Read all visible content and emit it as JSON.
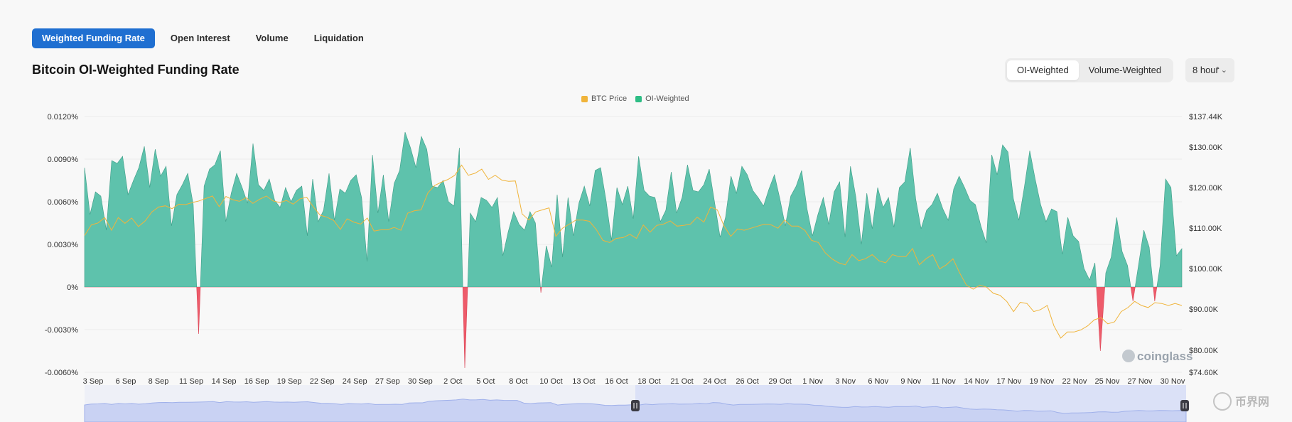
{
  "tabs": [
    "Weighted Funding Rate",
    "Open Interest",
    "Volume",
    "Liquidation"
  ],
  "title": "Bitcoin OI-Weighted Funding Rate",
  "weighting_options": [
    "OI-Weighted",
    "Volume-Weighted"
  ],
  "interval": {
    "label": "8 hour",
    "icon": "chevron-up-down-icon"
  },
  "watermarks": {
    "brand": "coinglass",
    "site": "币界网"
  },
  "colors": {
    "positive": "#5ec2ac",
    "negative": "#ee5b6a",
    "btc_price": "#f0b43b",
    "active_tab": "#1f6fd1"
  },
  "chart_data": {
    "type": "area",
    "legend": [
      "BTC Price",
      "OI-Weighted"
    ],
    "legend_position": "top-center",
    "grid": true,
    "y_left": {
      "ticks": [
        "0.0120%",
        "0.0090%",
        "0.0060%",
        "0.0030%",
        "0%",
        "-0.0030%",
        "-0.0060%"
      ],
      "range": [
        -0.006,
        0.012
      ],
      "unit": "%"
    },
    "y_right": {
      "ticks": [
        "$137.44K",
        "$130.00K",
        "$120.00K",
        "$110.00K",
        "$100.00K",
        "$90.00K",
        "$80.00K",
        "$74.60K"
      ]
    },
    "x_ticks": [
      "3 Sep",
      "6 Sep",
      "8 Sep",
      "11 Sep",
      "14 Sep",
      "16 Sep",
      "19 Sep",
      "22 Sep",
      "24 Sep",
      "27 Sep",
      "30 Sep",
      "2 Oct",
      "5 Oct",
      "8 Oct",
      "10 Oct",
      "13 Oct",
      "16 Oct",
      "18 Oct",
      "21 Oct",
      "24 Oct",
      "26 Oct",
      "29 Oct",
      "1 Nov",
      "3 Nov",
      "6 Nov",
      "9 Nov",
      "11 Nov",
      "14 Nov",
      "17 Nov",
      "19 Nov",
      "22 Nov",
      "25 Nov",
      "27 Nov",
      "30 Nov"
    ],
    "series": [
      {
        "name": "OI-Weighted",
        "unit": "%",
        "values": [
          0.0084,
          0.0051,
          0.0067,
          0.0064,
          0.004,
          0.0089,
          0.0087,
          0.0092,
          0.0065,
          0.0075,
          0.0084,
          0.0099,
          0.007,
          0.0097,
          0.0078,
          0.0085,
          0.0043,
          0.0065,
          0.0072,
          0.008,
          0.0058,
          -0.0033,
          0.0071,
          0.0083,
          0.0086,
          0.0096,
          0.0046,
          0.0066,
          0.008,
          0.007,
          0.0059,
          0.0101,
          0.0072,
          0.0068,
          0.0076,
          0.0061,
          0.0056,
          0.007,
          0.006,
          0.0068,
          0.0071,
          0.0036,
          0.0076,
          0.0046,
          0.0054,
          0.008,
          0.0047,
          0.0069,
          0.0066,
          0.0075,
          0.0079,
          0.0063,
          0.0018,
          0.0093,
          0.0052,
          0.0079,
          0.0046,
          0.0073,
          0.0082,
          0.0109,
          0.0098,
          0.0084,
          0.0106,
          0.0097,
          0.0071,
          0.007,
          0.0075,
          0.006,
          0.0057,
          0.0098,
          -0.0057,
          0.0052,
          0.0046,
          0.0063,
          0.0061,
          0.0056,
          0.0063,
          0.0022,
          0.0039,
          0.0053,
          0.0044,
          0.004,
          0.0053,
          0.0045,
          -0.0004,
          0.0029,
          0.0014,
          0.0065,
          0.0021,
          0.0063,
          0.0036,
          0.0059,
          0.0071,
          0.0057,
          0.0082,
          0.0084,
          0.0061,
          0.0033,
          0.007,
          0.0058,
          0.0071,
          0.0048,
          0.0092,
          0.0068,
          0.0064,
          0.0063,
          0.0046,
          0.0054,
          0.0081,
          0.0052,
          0.0063,
          0.0086,
          0.0068,
          0.0067,
          0.0072,
          0.0083,
          0.0059,
          0.0035,
          0.0049,
          0.0078,
          0.0066,
          0.0085,
          0.0079,
          0.0068,
          0.0063,
          0.0057,
          0.0069,
          0.0079,
          0.0062,
          0.0043,
          0.0064,
          0.0071,
          0.0082,
          0.0055,
          0.0036,
          0.0051,
          0.0063,
          0.0044,
          0.0067,
          0.0074,
          0.0035,
          0.0085,
          0.0063,
          0.003,
          0.0066,
          0.0041,
          0.007,
          0.0056,
          0.0063,
          0.0042,
          0.007,
          0.0074,
          0.0098,
          0.0062,
          0.0041,
          0.0054,
          0.0058,
          0.0066,
          0.0055,
          0.0047,
          0.0069,
          0.0078,
          0.007,
          0.0061,
          0.0058,
          0.0043,
          0.0031,
          0.0093,
          0.0079,
          0.01,
          0.0095,
          0.0062,
          0.0047,
          0.007,
          0.0096,
          0.0076,
          0.0058,
          0.0046,
          0.0055,
          0.0053,
          0.0023,
          0.0049,
          0.0036,
          0.0032,
          0.0013,
          0.0005,
          0.0017,
          -0.0045,
          0.001,
          0.0021,
          0.0049,
          0.0025,
          0.0015,
          -0.001,
          0.0015,
          0.004,
          0.0028,
          -0.001,
          0.0015,
          0.0076,
          0.007,
          0.0022,
          0.0027
        ]
      },
      {
        "name": "BTC Price",
        "unit": "USD",
        "values": [
          108200,
          110800,
          111300,
          112600,
          109500,
          112600,
          111200,
          112500,
          110400,
          111800,
          114000,
          115200,
          115500,
          114800,
          115900,
          115800,
          116300,
          116700,
          117300,
          117900,
          115300,
          117800,
          117000,
          116600,
          117500,
          116100,
          117100,
          117900,
          116700,
          116300,
          116800,
          115900,
          117200,
          117600,
          115200,
          113200,
          112700,
          111900,
          109700,
          112300,
          111500,
          111000,
          112500,
          109300,
          109600,
          109600,
          110200,
          109500,
          113700,
          114300,
          114500,
          118700,
          120500,
          121300,
          122000,
          123000,
          125500,
          123000,
          123500,
          124500,
          122000,
          123000,
          121800,
          121500,
          121600,
          113500,
          112000,
          114000,
          114500,
          115000,
          108000,
          110000,
          111000,
          112000,
          112000,
          111700,
          109700,
          107000,
          106500,
          107500,
          107700,
          108500,
          107500,
          110800,
          109000,
          110700,
          111000,
          111800,
          110500,
          110700,
          111000,
          112700,
          111500,
          115200,
          114500,
          110500,
          108000,
          109800,
          109500,
          110000,
          110500,
          111000,
          110800,
          110000,
          112000,
          110500,
          110500,
          109500,
          107000,
          106500,
          104000,
          102500,
          101500,
          101000,
          103500,
          102000,
          102500,
          103500,
          102000,
          101500,
          103500,
          103000,
          103000,
          105000,
          101000,
          102500,
          103500,
          100000,
          101000,
          102500,
          99000,
          96000,
          95000,
          96000,
          95500,
          94000,
          93500,
          92000,
          89500,
          91800,
          91500,
          89500,
          90000,
          91000,
          86000,
          83000,
          84500,
          84500,
          85000,
          86000,
          87500,
          88000,
          86500,
          87000,
          89500,
          90500,
          92000,
          91000,
          90500,
          91700,
          91500,
          91000,
          91500,
          91000
        ]
      }
    ]
  }
}
